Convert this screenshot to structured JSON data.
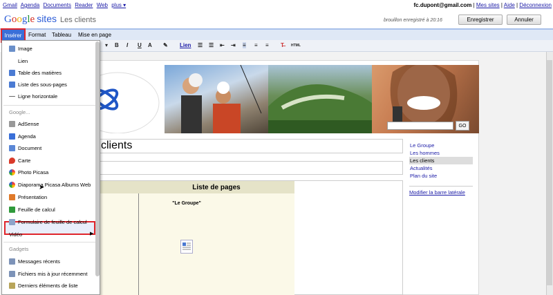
{
  "topnav": {
    "items": [
      "Gmail",
      "Agenda",
      "Documents",
      "Reader",
      "Web",
      "plus ▾"
    ]
  },
  "topright": {
    "email": "fc.dupont@gmail.com",
    "links": [
      "Mes sites",
      "Aide",
      "Déconnexion"
    ]
  },
  "header": {
    "logo": "Google",
    "product": "sites",
    "site_name": "Les clients",
    "draft_msg": "brouillon enregistré à 20:16",
    "save_label": "Enregistrer",
    "cancel_label": "Annuler"
  },
  "menubar": {
    "items": [
      "Insérer",
      "Format",
      "Tableau",
      "Mise en page"
    ]
  },
  "toolbar": {
    "bold": "B",
    "italic": "I",
    "underline": "U",
    "font_color": "A",
    "link": "Lien",
    "html": "HTML"
  },
  "dropdown": {
    "top_items": [
      "Image",
      "Lien",
      "Table des matières",
      "Liste des sous-pages",
      "Ligne horizontale"
    ],
    "google_header": "Google...",
    "google_items": [
      "AdSense",
      "Agenda",
      "Document",
      "Carte",
      "Photo Picasa",
      "Diaporama Picasa Albums Web",
      "Présentation",
      "Feuille de calcul",
      "Formulaire de feuille de calcul",
      "Vidéo"
    ],
    "gadgets_header": "Gadgets",
    "gadget_items": [
      "Messages récents",
      "Fichiers mis à jour récemment",
      "Derniers éléments de liste"
    ]
  },
  "page": {
    "title": "clients",
    "column_header": "Liste de pages",
    "quote_text": "\"Le Groupe\""
  },
  "search": {
    "button": "GO"
  },
  "sidebar": {
    "items": [
      "Le Groupe",
      "Les hommes",
      "Les clients",
      "Actualités",
      "Plan du site"
    ],
    "active_index": 2,
    "edit_link": "Modifier la barre latérale"
  }
}
